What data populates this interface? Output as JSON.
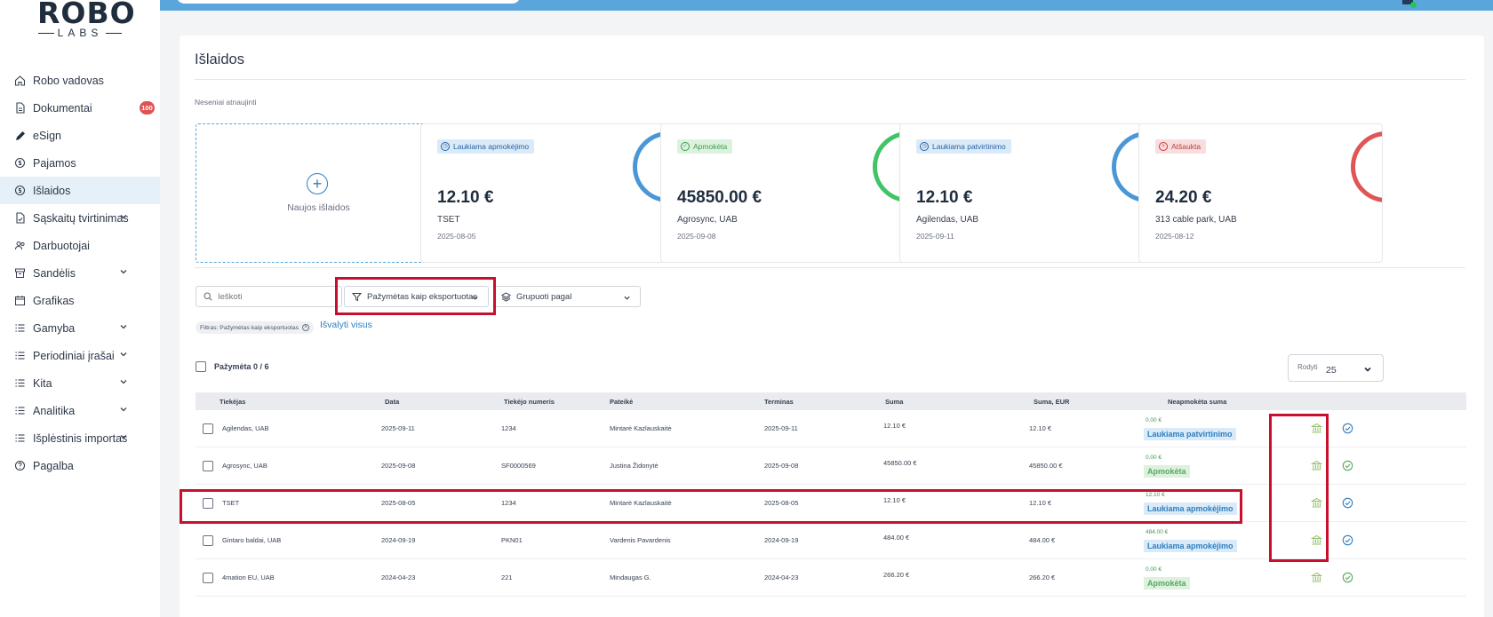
{
  "logo": {
    "main": "ROBO",
    "sub": "LABS"
  },
  "sidebar": {
    "items": [
      {
        "label": "Robo vadovas",
        "icon": "home-icon"
      },
      {
        "label": "Dokumentai",
        "icon": "document-icon",
        "badge": "100"
      },
      {
        "label": "eSign",
        "icon": "pen-icon"
      },
      {
        "label": "Pajamos",
        "icon": "coin-icon"
      },
      {
        "label": "Išlaidos",
        "icon": "coin-icon",
        "active": true
      },
      {
        "label": "Sąskaitų tvirtinimas",
        "icon": "file-check-icon",
        "chevron": true
      },
      {
        "label": "Darbuotojai",
        "icon": "users-icon"
      },
      {
        "label": "Sandėlis",
        "icon": "archive-icon",
        "chevron": true
      },
      {
        "label": "Grafikas",
        "icon": "calendar-icon"
      },
      {
        "label": "Gamyba",
        "icon": "list-icon",
        "chevron": true
      },
      {
        "label": "Periodiniai įrašai",
        "icon": "list-icon",
        "chevron": true
      },
      {
        "label": "Kita",
        "icon": "list-icon",
        "chevron": true
      },
      {
        "label": "Analitika",
        "icon": "list-icon",
        "chevron": true
      },
      {
        "label": "Išplėstinis importas",
        "icon": "list-icon",
        "chevron": true
      },
      {
        "label": "Pagalba",
        "icon": "help-icon"
      }
    ]
  },
  "page": {
    "title": "Išlaidos",
    "recent_label": "Neseniai atnaujinti",
    "new_card_label": "Naujos išlaidos"
  },
  "cards": [
    {
      "status": "Laukiama apmokėjimo",
      "color": "blue",
      "amount": "12.10 €",
      "supplier": "TSET",
      "date": "2025-08-05"
    },
    {
      "status": "Apmokėta",
      "color": "green",
      "amount": "45850.00 €",
      "supplier": "Agrosync, UAB",
      "date": "2025-09-08"
    },
    {
      "status": "Laukiama patvirtinimo",
      "color": "blue",
      "amount": "12.10 €",
      "supplier": "Agilendas, UAB",
      "date": "2025-09-11"
    },
    {
      "status": "Atšaukta",
      "color": "red",
      "amount": "24.20 €",
      "supplier": "313 cable park, UAB",
      "date": "2025-08-12"
    }
  ],
  "filters": {
    "search_placeholder": "Ieškoti",
    "export_filter": "Pažymėtas kaip eksportuotas",
    "group_by": "Grupuoti pagal",
    "active_chip": "Filtras: Pažymėtas kaip eksportuotas",
    "clear_all": "Išvalyti visus"
  },
  "selection": {
    "label": "Pažymėta 0 / 6"
  },
  "rows_per_page": {
    "label": "Rodyti",
    "value": "25"
  },
  "table": {
    "headers": [
      "Tiekėjas",
      "Data",
      "Tiekėjo numeris",
      "Pateikė",
      "Terminas",
      "Suma",
      "Suma, EUR",
      "Neapmokėta suma"
    ],
    "rows": [
      {
        "supplier": "Agilendas, UAB",
        "date": "2025-09-11",
        "number": "1234",
        "submitted_by": "Mintarė Kazlauskaitė",
        "due": "2025-09-11",
        "sum": "12.10 €",
        "sum_eur": "12.10 €",
        "unpaid": "0.00 €",
        "status": "Laukiama patvirtinimo",
        "status_color": "blue"
      },
      {
        "supplier": "Agrosync, UAB",
        "date": "2025-09-08",
        "number": "SF0000569",
        "submitted_by": "Justina Židonytė",
        "due": "2025-09-08",
        "sum": "45850.00 €",
        "sum_eur": "45850.00 €",
        "unpaid": "0.00 €",
        "status": "Apmokėta",
        "status_color": "green"
      },
      {
        "supplier": "TSET",
        "date": "2025-08-05",
        "number": "1234",
        "submitted_by": "Mintarė Kazlauskaitė",
        "due": "2025-08-05",
        "sum": "12.10 €",
        "sum_eur": "12.10 €",
        "unpaid": "12.10 €",
        "status": "Laukiama apmokėjimo",
        "status_color": "blue"
      },
      {
        "supplier": "Gintaro baldai, UAB",
        "date": "2024-09-19",
        "number": "PKN01",
        "submitted_by": "Vardenis Pavardenis",
        "due": "2024-09-19",
        "sum": "484.00 €",
        "sum_eur": "484.00 €",
        "unpaid": "484.00 €",
        "status": "Laukiama apmokėjimo",
        "status_color": "blue"
      },
      {
        "supplier": "4mation EU, UAB",
        "date": "2024-04-23",
        "number": "221",
        "submitted_by": "Mindaugas G.",
        "due": "2024-04-23",
        "sum": "266.20 €",
        "sum_eur": "266.20 €",
        "unpaid": "0.00 €",
        "status": "Apmokėta",
        "status_color": "green"
      }
    ]
  },
  "colors": {
    "accent": "#5aa6dc",
    "highlight": "#c8102e",
    "badge": "#e05252"
  }
}
